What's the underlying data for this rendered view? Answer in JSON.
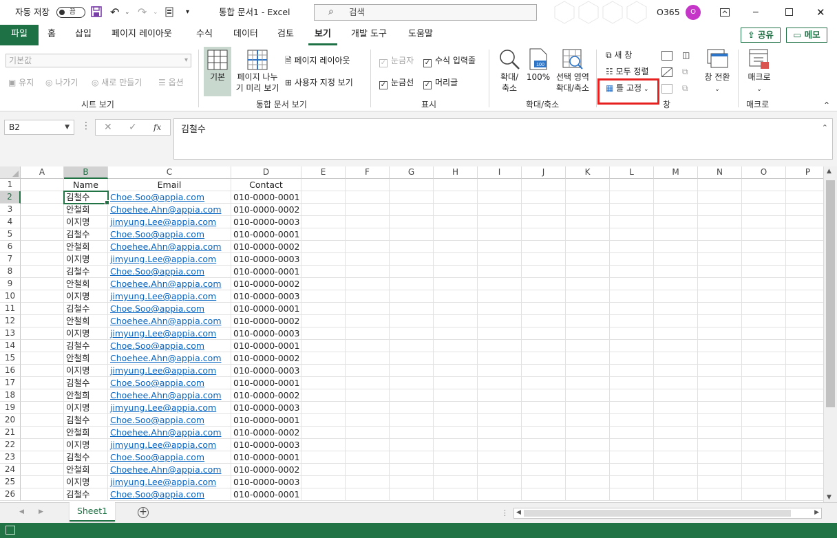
{
  "titlebar": {
    "autosave_label": "자동 저장",
    "autosave_state": "끔",
    "document_title": "통합 문서1  -  Excel",
    "search_placeholder": "검색",
    "account_label": "O365",
    "avatar_initial": "O"
  },
  "tabs": [
    {
      "label": "파일"
    },
    {
      "label": "홈"
    },
    {
      "label": "삽입"
    },
    {
      "label": "페이지 레이아웃"
    },
    {
      "label": "수식"
    },
    {
      "label": "데이터"
    },
    {
      "label": "검토"
    },
    {
      "label": "보기"
    },
    {
      "label": "개발 도구"
    },
    {
      "label": "도움말"
    }
  ],
  "share_label": "공유",
  "memo_label": "메모",
  "ribbon": {
    "sheet_view": {
      "select_value": "기본값",
      "keep": "유지",
      "exit": "나가기",
      "new": "새로 만들기",
      "options": "옵션",
      "group_label": "시트 보기"
    },
    "workbook_views": {
      "normal": "기본",
      "page_break_line1": "페이지 나누",
      "page_break_line2": "기 미리 보기",
      "page_layout": "페이지 레이아웃",
      "custom_views": "사용자 지정 보기",
      "group_label": "통합 문서 보기"
    },
    "show": {
      "ruler": "눈금자",
      "formula_bar": "수식 입력줄",
      "gridlines": "눈금선",
      "headings": "머리글",
      "group_label": "표시"
    },
    "zoom": {
      "zoom_line1": "확대/",
      "zoom_line2": "축소",
      "hundred": "100%",
      "selection_line1": "선택 영역",
      "selection_line2": "확대/축소",
      "group_label": "확대/축소"
    },
    "window": {
      "new_window": "새 창",
      "arrange_all": "모두 정렬",
      "freeze_panes": "틀 고정",
      "switch_windows": "창 전환",
      "group_label": "창"
    },
    "macros": {
      "label": "매크로",
      "group_label": "매크로"
    }
  },
  "formula_bar": {
    "name_box": "B2",
    "fx": "fx",
    "content": "김철수"
  },
  "columns": [
    "A",
    "B",
    "C",
    "D",
    "E",
    "F",
    "G",
    "H",
    "I",
    "J",
    "K",
    "L",
    "M",
    "N",
    "O",
    "P"
  ],
  "header_row": {
    "b": "Name",
    "c": "Email",
    "d": "Contact"
  },
  "rows": [
    {
      "n": "2",
      "b": "김철수",
      "c": "Choe.Soo@appia.com",
      "d": "010-0000-0001"
    },
    {
      "n": "3",
      "b": "안철희",
      "c": "Choehee.Ahn@appia.com",
      "d": "010-0000-0002"
    },
    {
      "n": "4",
      "b": "이지명",
      "c": "jimyung.Lee@appia.com",
      "d": "010-0000-0003"
    },
    {
      "n": "5",
      "b": "김철수",
      "c": "Choe.Soo@appia.com",
      "d": "010-0000-0001"
    },
    {
      "n": "6",
      "b": "안철희",
      "c": "Choehee.Ahn@appia.com",
      "d": "010-0000-0002"
    },
    {
      "n": "7",
      "b": "이지명",
      "c": "jimyung.Lee@appia.com",
      "d": "010-0000-0003"
    },
    {
      "n": "8",
      "b": "김철수",
      "c": "Choe.Soo@appia.com",
      "d": "010-0000-0001"
    },
    {
      "n": "9",
      "b": "안철희",
      "c": "Choehee.Ahn@appia.com",
      "d": "010-0000-0002"
    },
    {
      "n": "10",
      "b": "이지명",
      "c": "jimyung.Lee@appia.com",
      "d": "010-0000-0003"
    },
    {
      "n": "11",
      "b": "김철수",
      "c": "Choe.Soo@appia.com",
      "d": "010-0000-0001"
    },
    {
      "n": "12",
      "b": "안철희",
      "c": "Choehee.Ahn@appia.com",
      "d": "010-0000-0002"
    },
    {
      "n": "13",
      "b": "이지명",
      "c": "jimyung.Lee@appia.com",
      "d": "010-0000-0003"
    },
    {
      "n": "14",
      "b": "김철수",
      "c": "Choe.Soo@appia.com",
      "d": "010-0000-0001"
    },
    {
      "n": "15",
      "b": "안철희",
      "c": "Choehee.Ahn@appia.com",
      "d": "010-0000-0002"
    },
    {
      "n": "16",
      "b": "이지명",
      "c": "jimyung.Lee@appia.com",
      "d": "010-0000-0003"
    },
    {
      "n": "17",
      "b": "김철수",
      "c": "Choe.Soo@appia.com",
      "d": "010-0000-0001"
    },
    {
      "n": "18",
      "b": "안철희",
      "c": "Choehee.Ahn@appia.com",
      "d": "010-0000-0002"
    },
    {
      "n": "19",
      "b": "이지명",
      "c": "jimyung.Lee@appia.com",
      "d": "010-0000-0003"
    },
    {
      "n": "20",
      "b": "김철수",
      "c": "Choe.Soo@appia.com",
      "d": "010-0000-0001"
    },
    {
      "n": "21",
      "b": "안철희",
      "c": "Choehee.Ahn@appia.com",
      "d": "010-0000-0002"
    },
    {
      "n": "22",
      "b": "이지명",
      "c": "jimyung.Lee@appia.com",
      "d": "010-0000-0003"
    },
    {
      "n": "23",
      "b": "김철수",
      "c": "Choe.Soo@appia.com",
      "d": "010-0000-0001"
    },
    {
      "n": "24",
      "b": "안철희",
      "c": "Choehee.Ahn@appia.com",
      "d": "010-0000-0002"
    },
    {
      "n": "25",
      "b": "이지명",
      "c": "jimyung.Lee@appia.com",
      "d": "010-0000-0003"
    },
    {
      "n": "26",
      "b": "김철수",
      "c": "Choe.Soo@appia.com",
      "d": "010-0000-0001"
    }
  ],
  "sheet_tab": "Sheet1",
  "colors": {
    "excel_green": "#217346",
    "file_tab": "#1e7145",
    "link": "#0563c1",
    "highlight": "#e61f1f"
  }
}
